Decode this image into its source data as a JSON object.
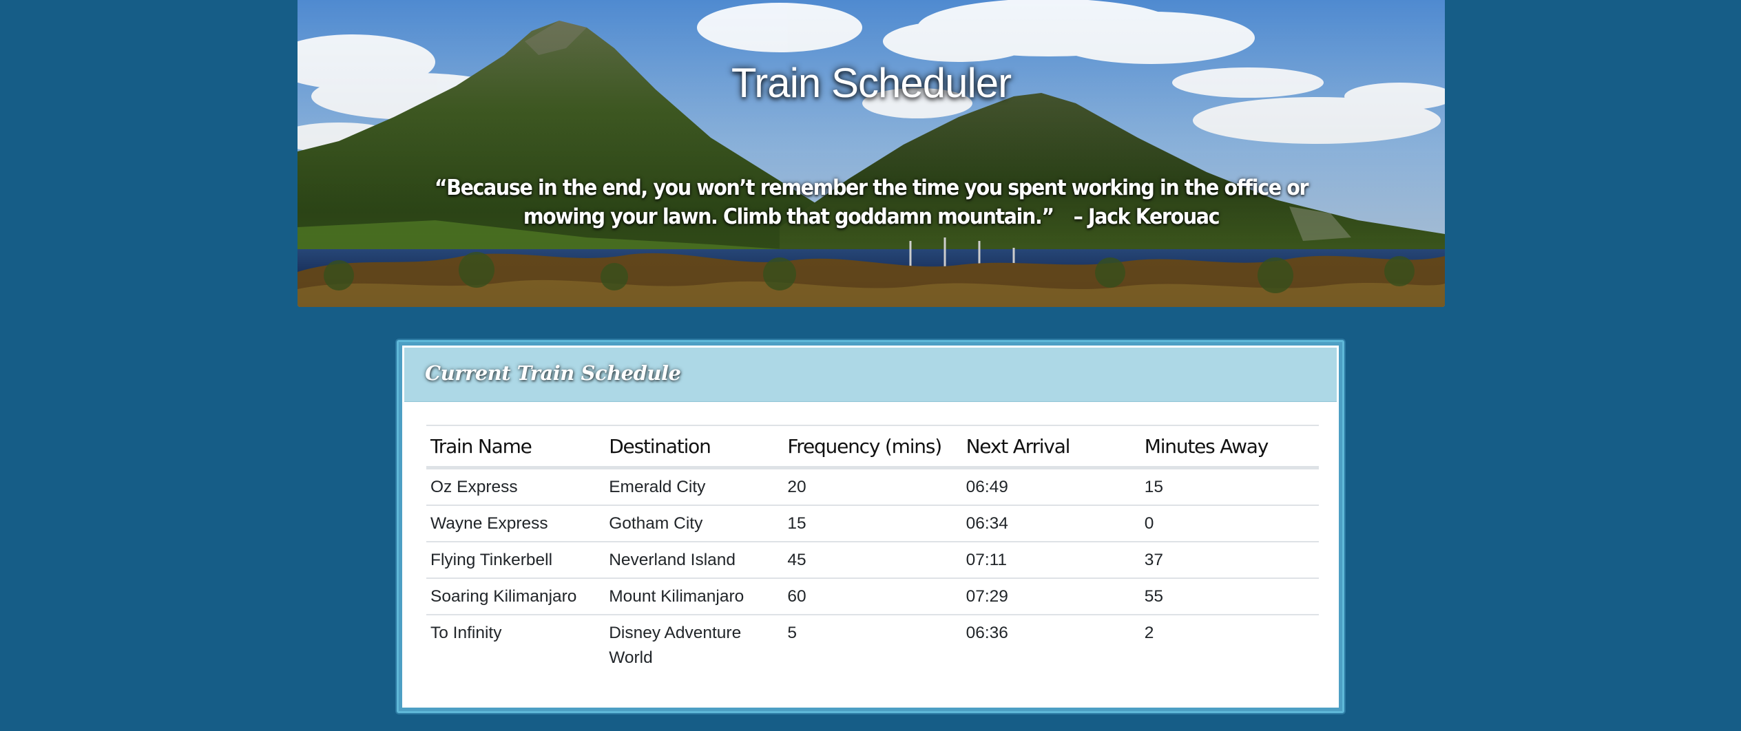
{
  "header": {
    "title": "Train Scheduler",
    "quote": "“Because in the end, you won’t remember the time you spent working in the office or mowing your lawn. Climb that goddamn mountain.”",
    "quote_author": "– Jack Kerouac"
  },
  "panel": {
    "title": "Current Train Schedule"
  },
  "table": {
    "columns": [
      "Train Name",
      "Destination",
      "Frequency (mins)",
      "Next Arrival",
      "Minutes Away"
    ],
    "rows": [
      [
        "Oz Express",
        "Emerald City",
        "20",
        "06:49",
        "15"
      ],
      [
        "Wayne Express",
        "Gotham City",
        "15",
        "06:34",
        "0"
      ],
      [
        "Flying Tinkerbell",
        "Neverland Island",
        "45",
        "07:11",
        "37"
      ],
      [
        "Soaring Kilimanjaro",
        "Mount Kilimanjaro",
        "60",
        "07:29",
        "55"
      ],
      [
        "To Infinity",
        "Disney Adventure World",
        "5",
        "06:36",
        "2"
      ]
    ]
  },
  "colors": {
    "page_background": "#165d87",
    "panel_heading": "#add8e6",
    "panel_border": "#5fb8d8"
  }
}
